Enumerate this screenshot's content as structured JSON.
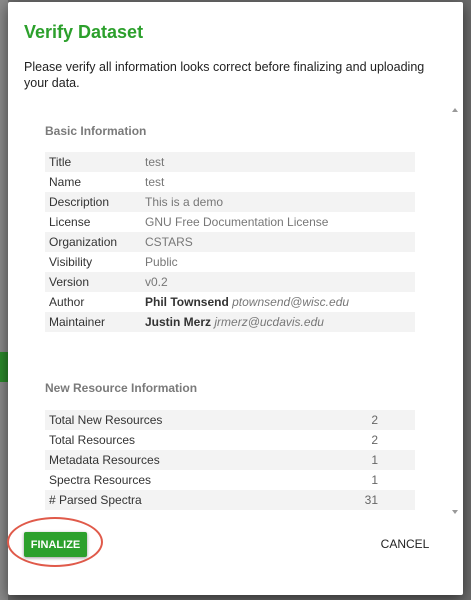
{
  "dialog": {
    "title": "Verify Dataset",
    "intro": "Please verify all information looks correct before finalizing and uploading your data."
  },
  "basic_info": {
    "heading": "Basic Information",
    "rows": [
      {
        "label": "Title",
        "value": "test"
      },
      {
        "label": "Name",
        "value": "test"
      },
      {
        "label": "Description",
        "value": "This is a demo"
      },
      {
        "label": "License",
        "value": "GNU Free Documentation License"
      },
      {
        "label": "Organization",
        "value": "CSTARS"
      },
      {
        "label": "Visibility",
        "value": "Public"
      },
      {
        "label": "Version",
        "value": "v0.2"
      },
      {
        "label": "Author",
        "name": "Phil Townsend",
        "email": "ptownsend@wisc.edu"
      },
      {
        "label": "Maintainer",
        "name": "Justin Merz",
        "email": "jrmerz@ucdavis.edu"
      }
    ]
  },
  "resource_info": {
    "heading": "New Resource Information",
    "rows": [
      {
        "label": "Total New Resources",
        "value": "2"
      },
      {
        "label": "Total Resources",
        "value": "2"
      },
      {
        "label": "Metadata Resources",
        "value": "1"
      },
      {
        "label": "Spectra Resources",
        "value": "1"
      },
      {
        "label": "# Parsed Spectra",
        "value": "31"
      }
    ]
  },
  "actions": {
    "finalize_label": "FINALIZE",
    "cancel_label": "CANCEL"
  },
  "colors": {
    "accent": "#2ca02c",
    "highlight_ring": "#e05a4a"
  }
}
